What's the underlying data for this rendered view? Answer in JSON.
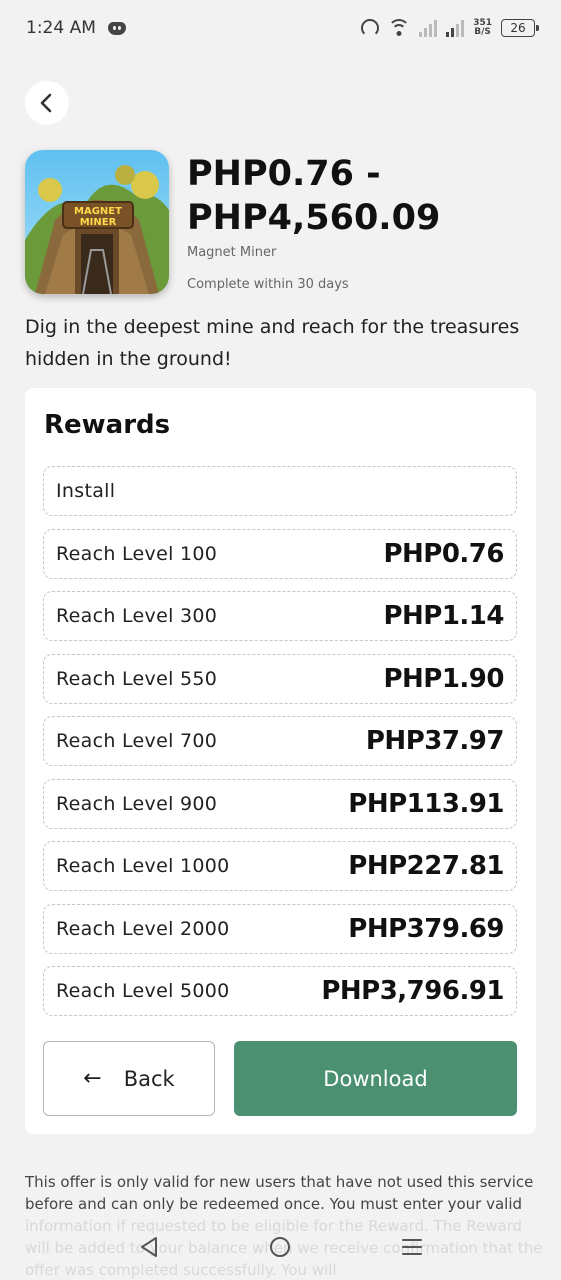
{
  "status_bar": {
    "time": "1:24 AM",
    "net_speed_value": "351",
    "net_speed_unit": "B/S",
    "battery": "26"
  },
  "offer": {
    "price_range": "PHP0.76 - PHP4,560.09",
    "app_name": "Magnet Miner",
    "deadline": "Complete within 30 days",
    "description": "Dig in the deepest mine and reach for the treasures hidden in the ground!",
    "icon_text_line1": "MAGNET",
    "icon_text_line2": "MINER"
  },
  "rewards": {
    "title": "Rewards",
    "items": [
      {
        "label": "Install",
        "value": ""
      },
      {
        "label": "Reach Level 100",
        "value": "PHP0.76"
      },
      {
        "label": "Reach Level 300",
        "value": "PHP1.14"
      },
      {
        "label": "Reach Level 550",
        "value": "PHP1.90"
      },
      {
        "label": "Reach Level 700",
        "value": "PHP37.97"
      },
      {
        "label": "Reach Level 900",
        "value": "PHP113.91"
      },
      {
        "label": "Reach Level 1000",
        "value": "PHP227.81"
      },
      {
        "label": "Reach Level 2000",
        "value": "PHP379.69"
      },
      {
        "label": "Reach Level 5000",
        "value": "PHP3,796.91"
      }
    ]
  },
  "buttons": {
    "back_label": "Back",
    "download_label": "Download"
  },
  "disclaimer": "This offer is only valid for new users that have not used this service before and can only be redeemed once. You must enter your valid information if requested to be eligible for the Reward. The Reward will be added to your balance when we receive confirmation that the offer was completed successfully. You will",
  "colors": {
    "accent": "#4a9071",
    "background": "#f2f2f2",
    "card": "#ffffff"
  }
}
